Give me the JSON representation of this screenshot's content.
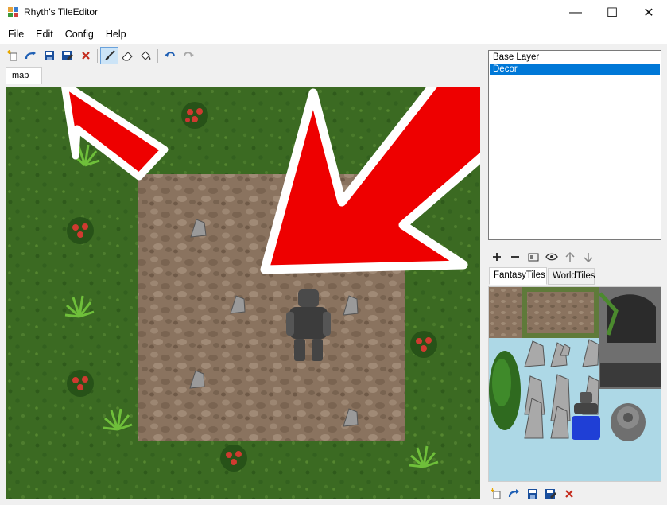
{
  "window": {
    "title": "Rhyth's TileEditor",
    "controls": {
      "minimize": "—",
      "maximize": "☐",
      "close": "✕"
    }
  },
  "menu": [
    "File",
    "Edit",
    "Config",
    "Help"
  ],
  "toolbar": {
    "buttons": [
      "new-file-icon",
      "open-icon",
      "save-icon",
      "save-as-icon",
      "close-icon",
      "brush-icon",
      "eraser-icon",
      "fill-icon",
      "undo-icon",
      "redo-icon"
    ],
    "active_tool": "brush-icon"
  },
  "document_tab": "map",
  "layers": {
    "items": [
      "Base Layer",
      "Decor"
    ],
    "selected": "Decor",
    "tools": [
      "add-icon",
      "remove-icon",
      "rename-icon",
      "visibility-icon",
      "move-up-icon",
      "move-down-icon"
    ]
  },
  "tileset_tabs": [
    "FantasyTiles",
    "WorldTiles"
  ],
  "active_tileset": "FantasyTiles",
  "tileset_toolbar": [
    "new-file-icon",
    "open-icon",
    "save-icon",
    "save-as-icon",
    "close-icon"
  ],
  "colors": {
    "grass": "#3b6a22",
    "dirt": "#8a735f",
    "selection": "#0078d7",
    "tileset_bg": "#add8e6",
    "arrow": "#ee0000"
  }
}
